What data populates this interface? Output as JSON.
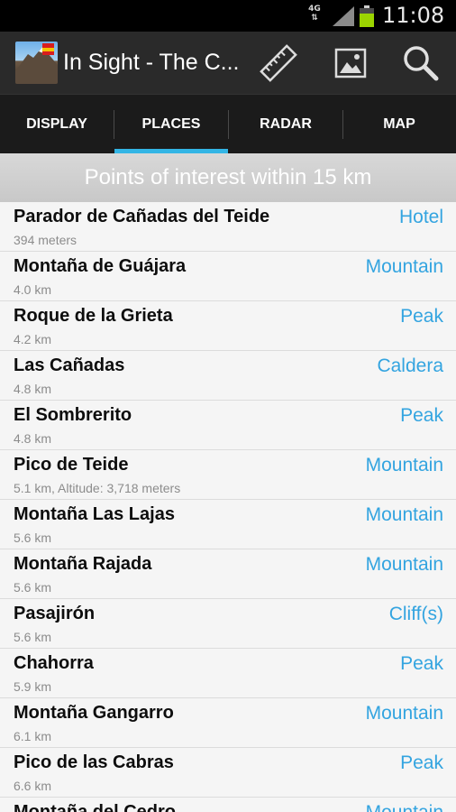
{
  "status_bar": {
    "network": "4G",
    "network_arrows": "⇅",
    "time": "11:08",
    "signal_icon": "signal-icon",
    "battery_icon": "battery-icon",
    "battery_color": "#9bd400"
  },
  "action_bar": {
    "app_title": "In Sight - The C...",
    "actions": [
      {
        "name": "measure",
        "icon": "ruler-icon"
      },
      {
        "name": "photo",
        "icon": "image-icon"
      },
      {
        "name": "search",
        "icon": "search-icon"
      }
    ]
  },
  "tabs": [
    {
      "label": "DISPLAY",
      "selected": false
    },
    {
      "label": "PLACES",
      "selected": true
    },
    {
      "label": "RADAR",
      "selected": false
    },
    {
      "label": "MAP",
      "selected": false
    }
  ],
  "section_header": "Points of interest within 15 km",
  "accent_color": "#33b5e5",
  "places": [
    {
      "name": "Parador de Cañadas del Teide",
      "distance": "394 meters",
      "type": "Hotel"
    },
    {
      "name": "Montaña de Guájara",
      "distance": "4.0 km",
      "type": "Mountain"
    },
    {
      "name": "Roque de la Grieta",
      "distance": "4.2 km",
      "type": "Peak"
    },
    {
      "name": "Las Cañadas",
      "distance": "4.8 km",
      "type": "Caldera"
    },
    {
      "name": "El Sombrerito",
      "distance": "4.8 km",
      "type": "Peak"
    },
    {
      "name": "Pico de Teide",
      "distance": "5.1 km, Altitude: 3,718 meters",
      "type": "Mountain"
    },
    {
      "name": "Montaña Las Lajas",
      "distance": "5.6 km",
      "type": "Mountain"
    },
    {
      "name": "Montaña Rajada",
      "distance": "5.6 km",
      "type": "Mountain"
    },
    {
      "name": "Pasajirón",
      "distance": "5.6 km",
      "type": "Cliff(s)"
    },
    {
      "name": "Chahorra",
      "distance": "5.9 km",
      "type": "Peak"
    },
    {
      "name": "Montaña Gangarro",
      "distance": "6.1 km",
      "type": "Mountain"
    },
    {
      "name": "Pico de las Cabras",
      "distance": "6.6 km",
      "type": "Peak"
    },
    {
      "name": "Montaña del Cedro",
      "distance": "",
      "type": "Mountain"
    }
  ]
}
